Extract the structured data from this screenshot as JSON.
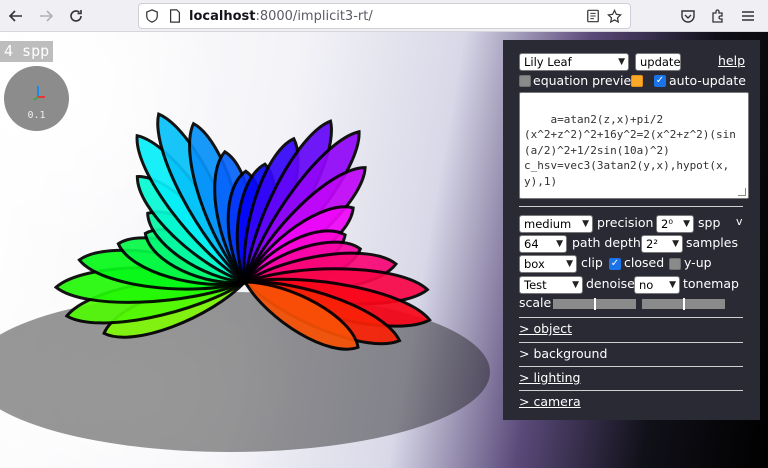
{
  "browser": {
    "url_host": "localhost",
    "url_path": ":8000/implicit3-rt/"
  },
  "viewport": {
    "spp_counter": "4 spp",
    "gizmo_label": "0.1"
  },
  "panel": {
    "preset_select": "Lily Leaf",
    "update_button": "update",
    "help_link": "help",
    "equation_preview_label": "equation preview",
    "equation_preview_checked": false,
    "auto_update_label": "auto-update",
    "auto_update_checked": true,
    "equation_text": "a=atan2(z,x)+pi/2\n(x^2+z^2)^2+16y^2=2(x^2+z^2)(sin(a/2)^2+1/2sin(10a)^2)\nc_hsv=vec3(3atan2(y,x),hypot(x,y),1)",
    "collapse_toggle": "v",
    "quality_select": "medium",
    "precision_label": "precision",
    "spp_select": "2⁰",
    "spp_label": "spp",
    "path_depth_select": "64",
    "path_depth_label": "path depth",
    "samples_select": "2²",
    "samples_label": "samples",
    "clip_select": "box",
    "clip_label": "clip",
    "closed_label": "closed",
    "closed_checked": true,
    "y_up_label": "y-up",
    "y_up_checked": false,
    "denoise_select": "Test",
    "denoise_label": "denoise",
    "tonemap_select": "no",
    "tonemap_label": "tonemap",
    "scale_label": "scale",
    "scale_slider_1": 0.5,
    "scale_slider_2": 0.5,
    "sections": [
      "> object",
      "> background",
      "> lighting",
      "> camera"
    ]
  },
  "colors": {
    "panel_bg": "#2a2a35",
    "checkbox_blue": "#1a73e8",
    "checkbox_orange": "#ffa726"
  }
}
